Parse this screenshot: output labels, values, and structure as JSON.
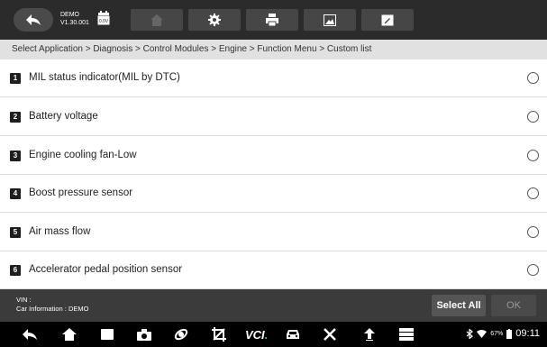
{
  "header": {
    "app_name": "DEMO",
    "version": "V1.30.001",
    "battery_voltage": "0.0V"
  },
  "breadcrumb": "Select Application > Diagnosis > Control Modules > Engine > Function Menu > Custom list",
  "items": [
    {
      "num": "1",
      "label": "MIL status indicator(MIL by DTC)"
    },
    {
      "num": "2",
      "label": "Battery voltage"
    },
    {
      "num": "3",
      "label": "Engine cooling fan-Low"
    },
    {
      "num": "4",
      "label": "Boost pressure sensor"
    },
    {
      "num": "5",
      "label": "Air mass flow"
    },
    {
      "num": "6",
      "label": "Accelerator pedal position sensor"
    }
  ],
  "footer": {
    "vin_label": "VIN :",
    "car_info": "Car Information : DEMO",
    "select_all": "Select All",
    "ok": "OK"
  },
  "navbar": {
    "vci_label": "VCI",
    "battery_pct": "67%",
    "time": "09:11"
  }
}
